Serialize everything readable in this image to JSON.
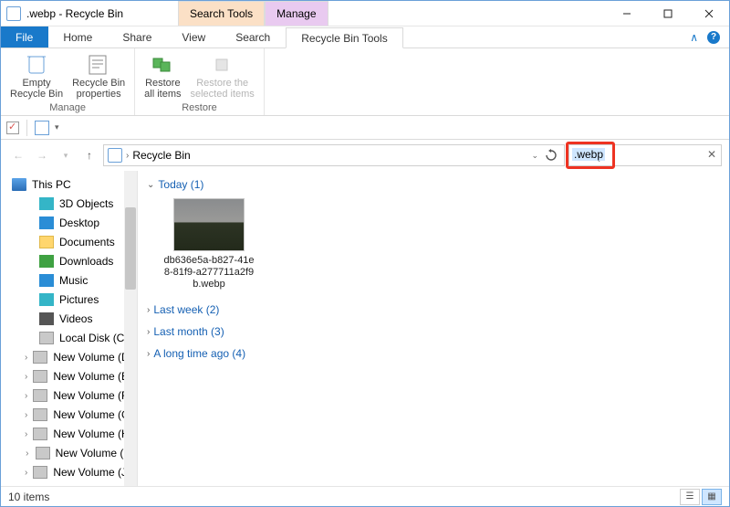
{
  "window": {
    "title": ".webp - Recycle Bin",
    "context_tabs": {
      "search": "Search Tools",
      "manage": "Manage"
    }
  },
  "menu": {
    "file": "File",
    "tabs": [
      "Home",
      "Share",
      "View",
      "Search",
      "Recycle Bin Tools"
    ]
  },
  "ribbon": {
    "manage_group": "Manage",
    "restore_group": "Restore",
    "empty": "Empty\nRecycle Bin",
    "props": "Recycle Bin\nproperties",
    "restore_all": "Restore\nall items",
    "restore_sel": "Restore the\nselected items"
  },
  "address": {
    "location": "Recycle Bin"
  },
  "search": {
    "value": ".webp"
  },
  "sidebar": {
    "root": "This PC",
    "items": [
      {
        "label": "3D Objects",
        "cls": "ico-3d"
      },
      {
        "label": "Desktop",
        "cls": "ico-desktop"
      },
      {
        "label": "Documents",
        "cls": "ico-folder"
      },
      {
        "label": "Downloads",
        "cls": "ico-dl"
      },
      {
        "label": "Music",
        "cls": "ico-music"
      },
      {
        "label": "Pictures",
        "cls": "ico-pic"
      },
      {
        "label": "Videos",
        "cls": "ico-vid"
      },
      {
        "label": "Local Disk (C:)",
        "cls": "ico-disk"
      },
      {
        "label": "New Volume (D:)",
        "cls": "ico-disk",
        "chev": true
      },
      {
        "label": "New Volume (E:)",
        "cls": "ico-disk",
        "chev": true
      },
      {
        "label": "New Volume (F:)",
        "cls": "ico-disk",
        "chev": true
      },
      {
        "label": "New Volume (G:)",
        "cls": "ico-disk",
        "chev": true
      },
      {
        "label": "New Volume (H:)",
        "cls": "ico-disk",
        "chev": true
      },
      {
        "label": "New Volume (I:)",
        "cls": "ico-disk",
        "chev": true
      },
      {
        "label": "New Volume (J:)",
        "cls": "ico-disk",
        "chev": true
      }
    ]
  },
  "groups": [
    {
      "label": "Today (1)",
      "expanded": true,
      "items": [
        {
          "name": "db636e5a-b827-41e8-81f9-a277711a2f9b.webp"
        }
      ]
    },
    {
      "label": "Last week (2)",
      "expanded": false
    },
    {
      "label": "Last month (3)",
      "expanded": false
    },
    {
      "label": "A long time ago (4)",
      "expanded": false
    }
  ],
  "status": {
    "count": "10 items"
  }
}
